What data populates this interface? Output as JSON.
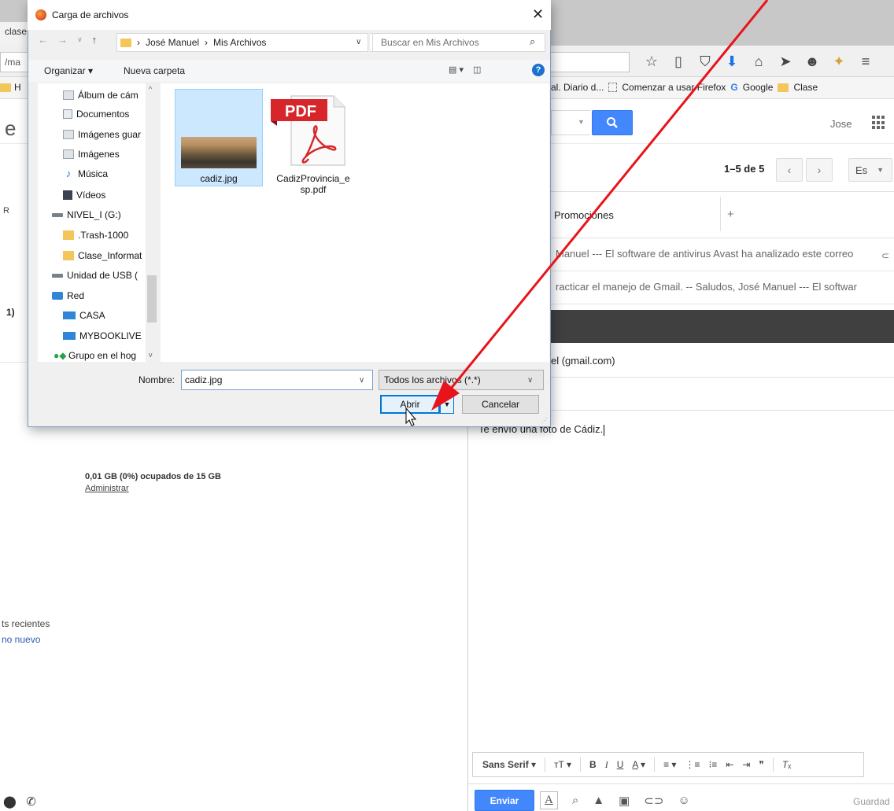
{
  "browser": {
    "tab_label": "clase",
    "url_fragment": "/ma",
    "bookmarks_left_text": "H",
    "bookmarks": [
      "al. Diario d...",
      "Comenzar a usar Firefox",
      "Google",
      "Clase"
    ]
  },
  "gmail": {
    "left_logo_fragment": "e",
    "user_name": "Jose",
    "pager_text": "1–5 de 5",
    "lang_button": "Es",
    "left_label_fragment": "R",
    "left_count_fragment": "1)",
    "tab_promotions": "Promociones",
    "tab_add": "+",
    "rows": [
      "Manuel --- El software de antivirus Avast ha analizado este correo",
      "racticar el manejo de Gmail. -- Saludos, José Manuel --- El softwar"
    ],
    "to_fragment": "el (gmail.com)",
    "body_text": "Te envío una foto de Cádiz.",
    "format_font": "Sans Serif",
    "send_button": "Enviar",
    "saved_text": "Guardad",
    "storage_text": "0,01 GB (0%) ocupados de 15 GB",
    "manage_link": "Administrar",
    "recents_fragment": "ts recientes",
    "new_fragment": "no nuevo"
  },
  "dialog": {
    "title": "Carga de archivos",
    "path": [
      "José Manuel",
      "Mis Archivos"
    ],
    "search_placeholder": "Buscar en Mis Archivos",
    "organize_label": "Organizar ▾",
    "new_folder_label": "Nueva carpeta",
    "tree": [
      {
        "label": "Álbum de cám",
        "icon": "folder-pictures-icon"
      },
      {
        "label": "Documentos",
        "icon": "documents-icon"
      },
      {
        "label": "Imágenes guar",
        "icon": "folder-pictures-icon"
      },
      {
        "label": "Imágenes",
        "icon": "folder-pictures-icon"
      },
      {
        "label": "Música",
        "icon": "music-icon"
      },
      {
        "label": "Vídeos",
        "icon": "videos-icon"
      },
      {
        "label": "NIVEL_I (G:)",
        "icon": "drive-icon"
      },
      {
        "label": ".Trash-1000",
        "icon": "folder-icon"
      },
      {
        "label": "Clase_Informat",
        "icon": "folder-icon"
      },
      {
        "label": "Unidad de USB (",
        "icon": "usb-drive-icon"
      },
      {
        "label": "Red",
        "icon": "network-icon"
      },
      {
        "label": "CASA",
        "icon": "computer-icon"
      },
      {
        "label": "MYBOOKLIVE",
        "icon": "computer-icon"
      },
      {
        "label": "Grupo en el hog",
        "icon": "homegroup-icon"
      }
    ],
    "files": [
      {
        "name": "cadiz.jpg",
        "type": "image",
        "selected": true
      },
      {
        "name": "CadizProvincia_esp.pdf",
        "name_line1": "CadizProvincia_e",
        "name_line2": "sp.pdf",
        "type": "pdf",
        "selected": false
      }
    ],
    "pdf_badge": "PDF",
    "name_label": "Nombre:",
    "name_value": "cadiz.jpg",
    "filter_value": "Todos los archivos (*.*)",
    "open_button": "Abrir",
    "cancel_button": "Cancelar"
  },
  "colors": {
    "gmail_blue": "#4387fd",
    "selection": "#cce8ff",
    "annotation_arrow": "#e8141b",
    "pdf_red": "#d7262b"
  }
}
